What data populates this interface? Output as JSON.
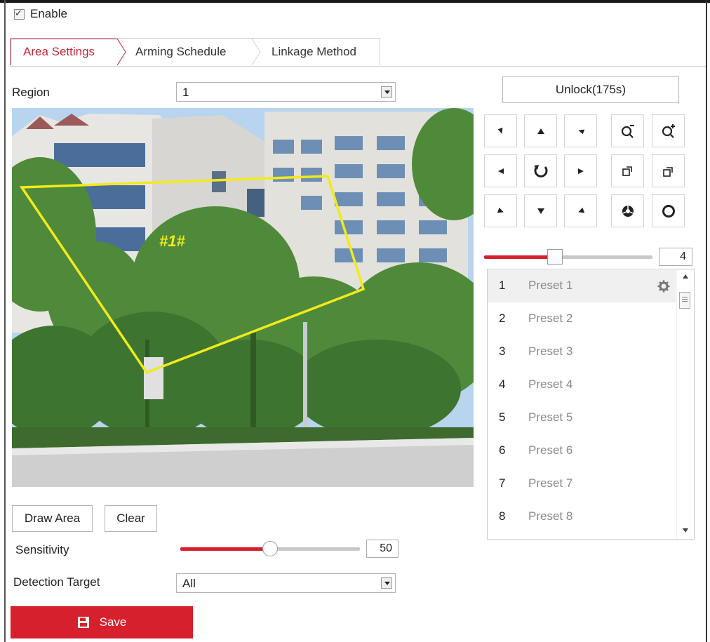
{
  "enable": {
    "label": "Enable",
    "checked": true
  },
  "tabs": [
    {
      "label": "Area Settings",
      "active": true
    },
    {
      "label": "Arming Schedule",
      "active": false
    },
    {
      "label": "Linkage Method",
      "active": false
    }
  ],
  "region": {
    "label": "Region",
    "value": "1"
  },
  "video": {
    "region_tag": "#1#"
  },
  "ptz": {
    "unlock_label": "Unlock(175s)",
    "speed_value": "4",
    "speed_fraction": 0.42,
    "buttons": [
      "up-left-icon",
      "up-icon",
      "up-right-icon",
      "zoom-out-icon",
      "zoom-in-icon",
      "left-icon",
      "auto-pan-icon",
      "right-icon",
      "focus-near-icon",
      "focus-far-icon",
      "down-left-icon",
      "down-icon",
      "down-right-icon",
      "iris-open-icon",
      "iris-close-icon"
    ]
  },
  "presets": [
    {
      "num": "1",
      "name": "Preset 1",
      "selected": true
    },
    {
      "num": "2",
      "name": "Preset 2"
    },
    {
      "num": "3",
      "name": "Preset 3"
    },
    {
      "num": "4",
      "name": "Preset 4"
    },
    {
      "num": "5",
      "name": "Preset 5"
    },
    {
      "num": "6",
      "name": "Preset 6"
    },
    {
      "num": "7",
      "name": "Preset 7"
    },
    {
      "num": "8",
      "name": "Preset 8"
    }
  ],
  "actions": {
    "draw_area": "Draw Area",
    "clear": "Clear"
  },
  "sensitivity": {
    "label": "Sensitivity",
    "value": "50",
    "fraction": 0.5
  },
  "detection_target": {
    "label": "Detection Target",
    "value": "All"
  },
  "save": {
    "label": "Save"
  },
  "colors": {
    "accent": "#d6202d",
    "region_outline": "#f2ea1a"
  }
}
